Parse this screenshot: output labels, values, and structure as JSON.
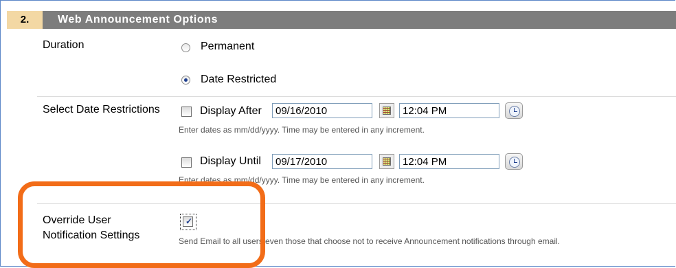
{
  "section": {
    "step_number": "2.",
    "title": "Web Announcement Options"
  },
  "duration": {
    "label": "Duration",
    "options": [
      {
        "label": "Permanent",
        "selected": false
      },
      {
        "label": "Date Restricted",
        "selected": true
      }
    ]
  },
  "date_restrictions": {
    "label": "Select Date Restrictions",
    "display_after": {
      "label": "Display After",
      "checked": false,
      "date": "09/16/2010",
      "time": "12:04 PM"
    },
    "display_until": {
      "label": "Display Until",
      "checked": false,
      "date": "09/17/2010",
      "time": "12:04 PM"
    },
    "hint": "Enter dates as mm/dd/yyyy. Time may be entered in any increment."
  },
  "override": {
    "label_line1": "Override User",
    "label_line2": "Notification Settings",
    "checked": true,
    "hint": "Send Email to all users even those that choose not to receive Announcement notifications through email."
  },
  "colors": {
    "header_bg": "#7d7d7d",
    "step_bg": "#f3d8a4",
    "highlight": "#f26c18",
    "frame_border": "#5b87c8"
  },
  "icons": [
    "calendar-icon",
    "clock-icon"
  ]
}
